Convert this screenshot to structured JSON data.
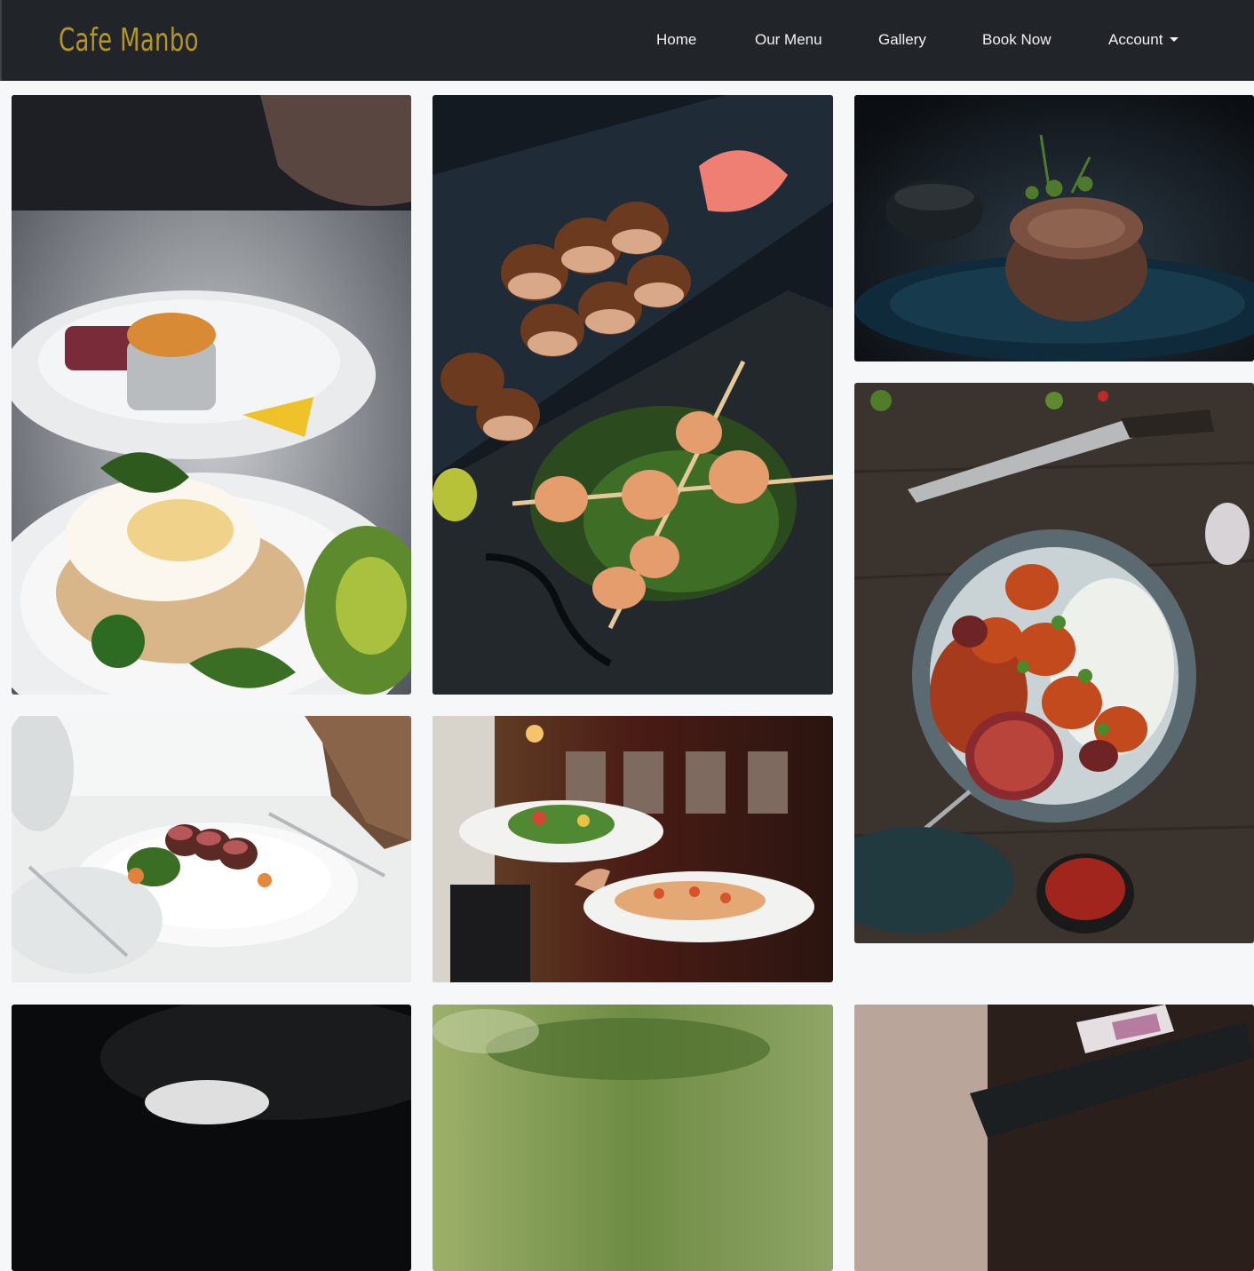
{
  "brand": {
    "name": "Cafe Manbo",
    "color": "#b5961f"
  },
  "nav": {
    "home": "Home",
    "menu": "Our Menu",
    "gallery": "Gallery",
    "book": "Book Now",
    "account": "Account"
  },
  "gallery": {
    "photos": [
      {
        "subject": "eggs benedict with avocado and poached eggs"
      },
      {
        "subject": "grilled shrimp skewers and scallops on slate"
      },
      {
        "subject": "beef fillet with microgreens"
      },
      {
        "subject": "kebab skewers with rice and chef knife"
      },
      {
        "subject": "sliced steak on white plate"
      },
      {
        "subject": "waiter serving salad and bruschetta"
      },
      {
        "subject": "dark dish on black plate"
      },
      {
        "subject": "blurred green background"
      },
      {
        "subject": "wine bottle"
      }
    ]
  }
}
